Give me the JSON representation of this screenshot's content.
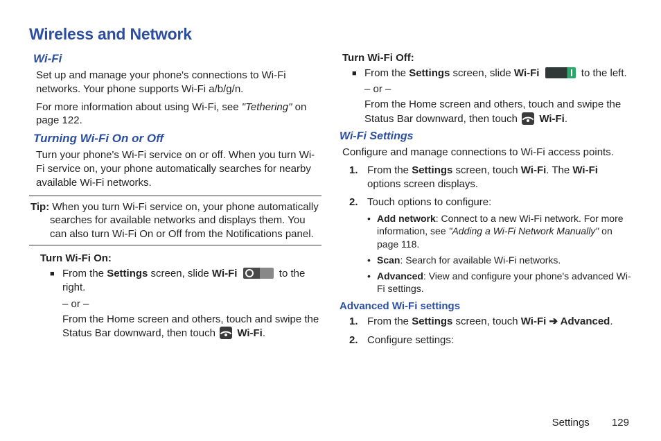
{
  "title": "Wireless and Network",
  "left": {
    "wifi_heading": "Wi-Fi",
    "wifi_p1": "Set up and manage your phone's connections to Wi-Fi networks. Your phone supports Wi-Fi a/b/g/n.",
    "wifi_p2_pre": "For more information about using Wi-Fi, see ",
    "wifi_p2_ref": "\"Tethering\"",
    "wifi_p2_post": " on page 122.",
    "turning_heading": "Turning Wi-Fi On or Off",
    "turning_p": "Turn your phone's Wi-Fi service on or off. When you turn Wi-Fi service on, your phone automatically searches for nearby available Wi-Fi networks.",
    "tip_label": "Tip:",
    "tip_text": " When you turn Wi-Fi service on, your phone automatically searches for available networks and displays them. You can also turn Wi-Fi On or Off from the Notifications panel.",
    "on_heading": "Turn Wi-Fi On:",
    "on_line1_a": "From the ",
    "on_line1_settings": "Settings",
    "on_line1_b": " screen, slide ",
    "on_line1_wifi": "Wi-Fi",
    "on_line1_c": " to the right.",
    "or": "– or –",
    "on_line2_a": "From the Home screen and others, touch and swipe the Status Bar downward, then touch ",
    "on_line2_wifi": "Wi-Fi",
    "on_line2_b": "."
  },
  "right": {
    "off_heading": "Turn Wi-Fi Off:",
    "off_line1_a": "From the ",
    "off_line1_settings": "Settings",
    "off_line1_b": " screen, slide ",
    "off_line1_wifi": "Wi-Fi",
    "off_line1_c": " to the left.",
    "or": "– or –",
    "off_line2_a": "From the Home screen and others, touch and swipe the Status Bar downward, then touch ",
    "off_line2_wifi": "Wi-Fi",
    "off_line2_b": ".",
    "settings_heading": "Wi-Fi Settings",
    "settings_p": "Configure and manage connections to Wi-Fi access points.",
    "step1_a": "From the ",
    "step1_settings": "Settings",
    "step1_b": " screen, touch ",
    "step1_wifi": "Wi-Fi",
    "step1_c": ". The ",
    "step1_wifi2": "Wi-Fi",
    "step1_d": " options screen displays.",
    "step2": "Touch options to configure:",
    "bul1_label": "Add network",
    "bul1_a": ": Connect to a new Wi-Fi network. For more information, see ",
    "bul1_ref": "\"Adding a Wi-Fi Network Manually\"",
    "bul1_b": " on page 118.",
    "bul2_label": "Scan",
    "bul2_a": ": Search for available Wi-Fi networks.",
    "bul3_label": "Advanced",
    "bul3_a": ": View and configure your phone's advanced Wi-Fi settings.",
    "adv_heading": "Advanced Wi-Fi settings",
    "adv1_a": "From the ",
    "adv1_settings": "Settings",
    "adv1_b": " screen, touch ",
    "adv1_wifi": "Wi-Fi",
    "adv1_arrow": " ➔ ",
    "adv1_adv": "Advanced",
    "adv1_c": ".",
    "adv2": "Configure settings:"
  },
  "footer": {
    "section": "Settings",
    "page": "129"
  },
  "numbers": {
    "n1": "1.",
    "n2": "2."
  }
}
